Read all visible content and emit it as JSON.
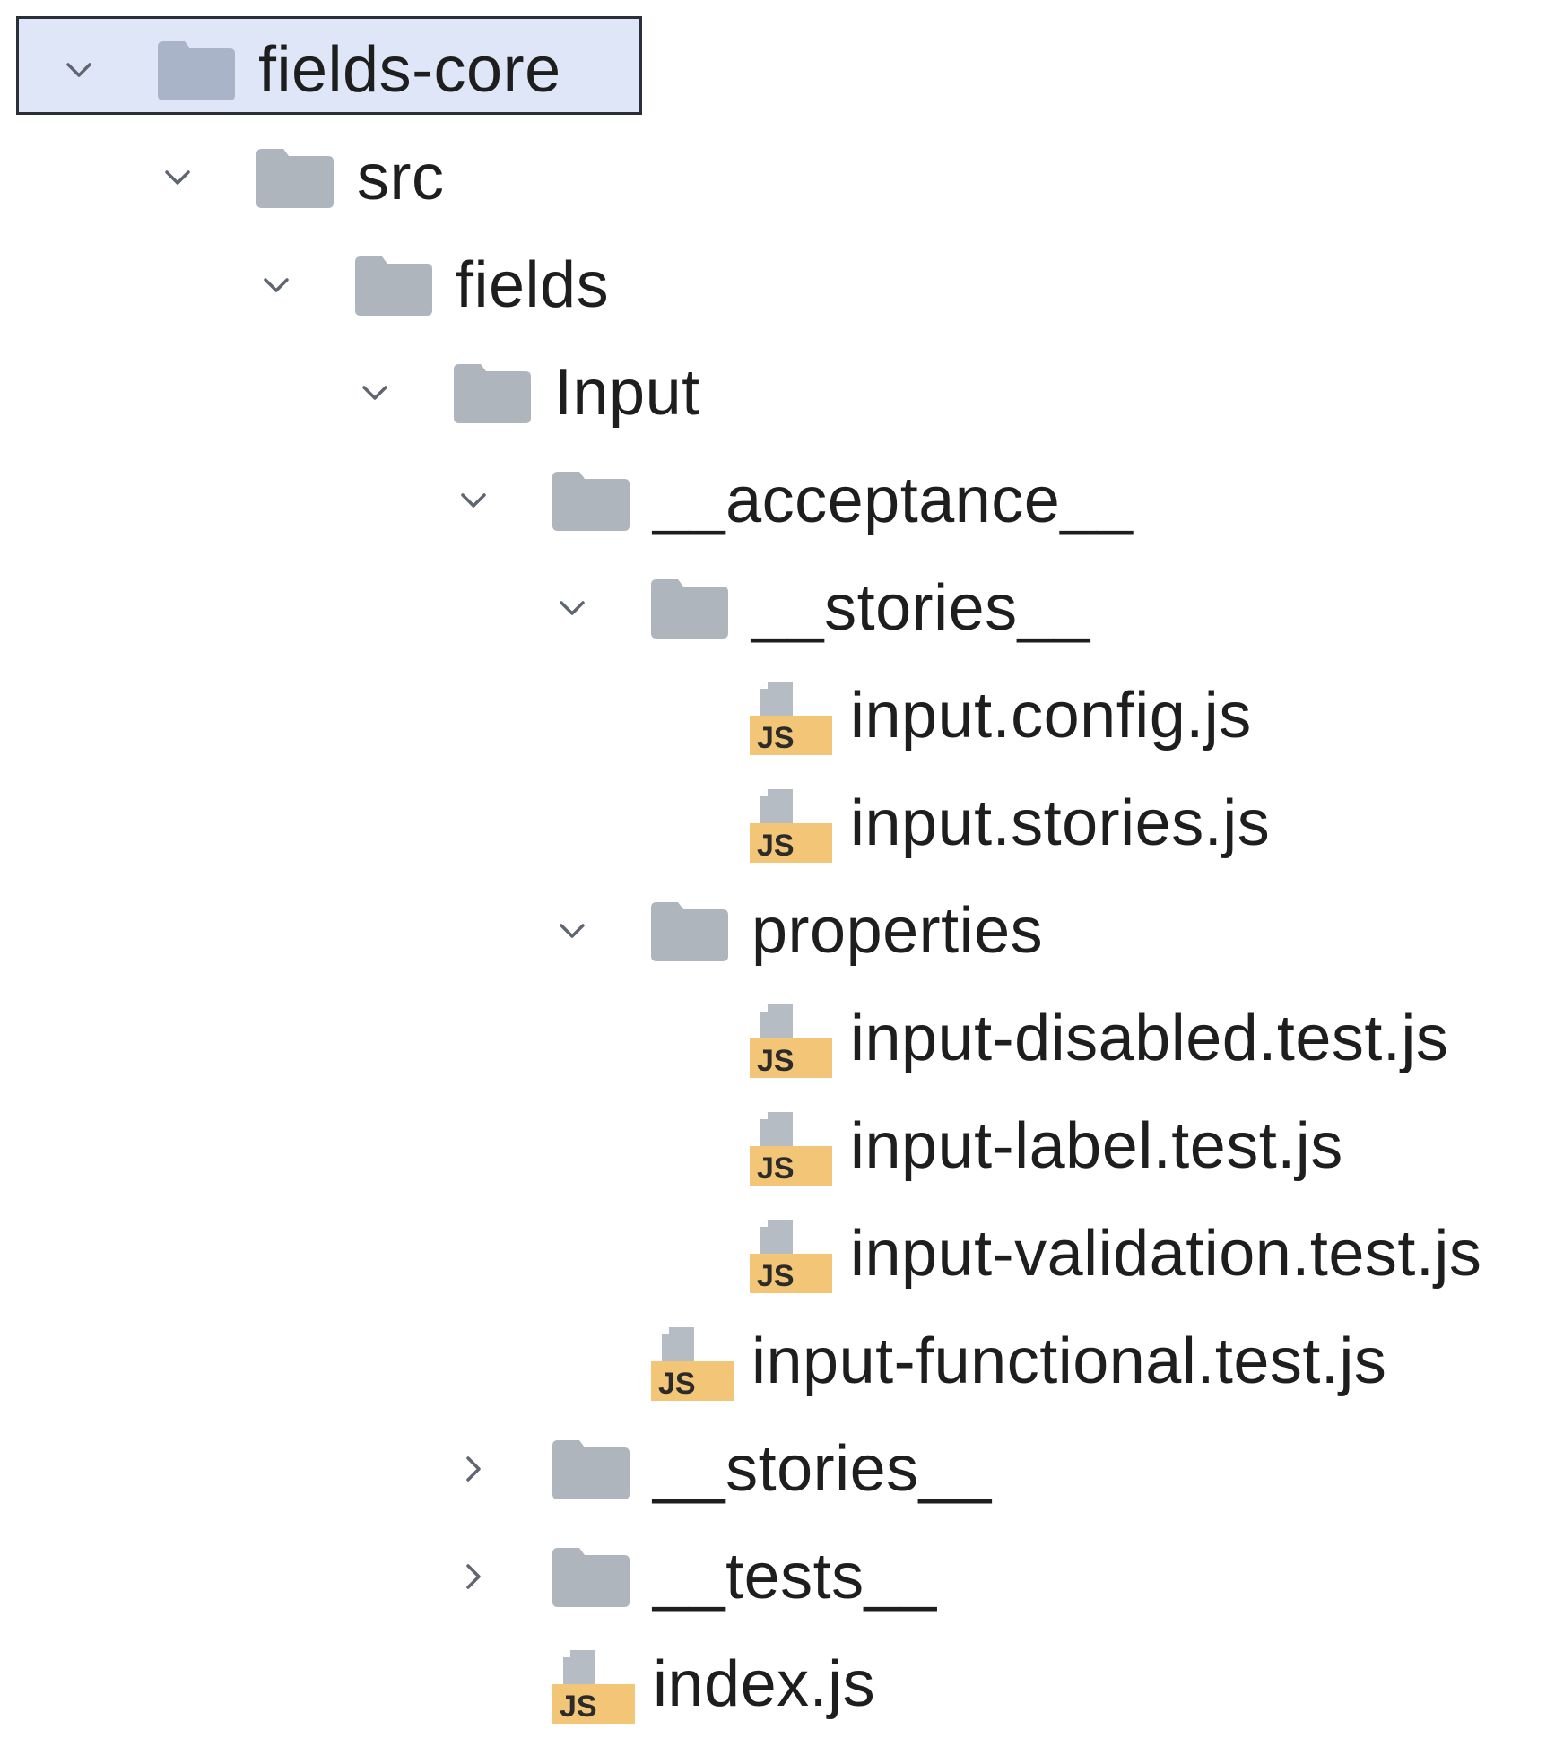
{
  "tree": {
    "items": [
      {
        "label": "fields-core",
        "type": "folder",
        "expanded": true,
        "selected": true
      },
      {
        "label": "src",
        "type": "folder",
        "expanded": true
      },
      {
        "label": "fields",
        "type": "folder",
        "expanded": true
      },
      {
        "label": "Input",
        "type": "folder",
        "expanded": true
      },
      {
        "label": "__acceptance__",
        "type": "folder",
        "expanded": true
      },
      {
        "label": "__stories__",
        "type": "folder",
        "expanded": true
      },
      {
        "label": "input.config.js",
        "type": "js-file"
      },
      {
        "label": "input.stories.js",
        "type": "js-file"
      },
      {
        "label": "properties",
        "type": "folder",
        "expanded": true
      },
      {
        "label": "input-disabled.test.js",
        "type": "js-file"
      },
      {
        "label": "input-label.test.js",
        "type": "js-file"
      },
      {
        "label": "input-validation.test.js",
        "type": "js-file"
      },
      {
        "label": "input-functional.test.js",
        "type": "js-file"
      },
      {
        "label": "__stories__",
        "type": "folder",
        "expanded": false
      },
      {
        "label": "__tests__",
        "type": "folder",
        "expanded": false
      },
      {
        "label": "index.js",
        "type": "js-file"
      }
    ],
    "icons": {
      "folder_color_selected": "#a9b4c9",
      "folder_color": "#aeb5bc",
      "js_badge_color": "#f3c677",
      "js_doc_color": "#b5bcc4",
      "js_badge_text": "JS",
      "chevron_color": "#5f6670"
    }
  }
}
